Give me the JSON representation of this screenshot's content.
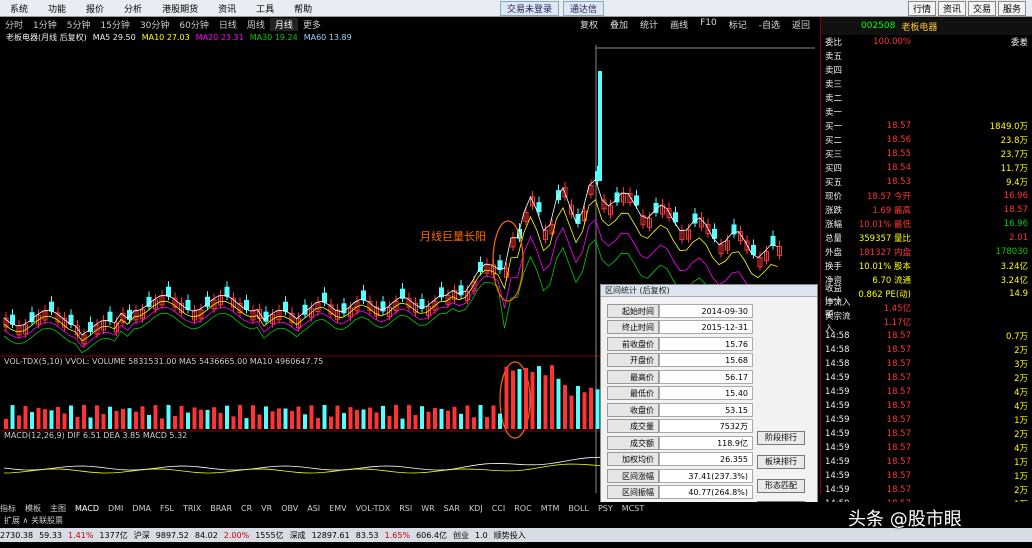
{
  "menu": {
    "items": [
      "系统",
      "功能",
      "报价",
      "分析",
      "港股期货",
      "资讯",
      "工具",
      "帮助"
    ],
    "center": [
      "交易未登录",
      "通达信"
    ],
    "right": [
      "行情",
      "资讯",
      "交易",
      "服务"
    ]
  },
  "periods": {
    "items": [
      "分时",
      "1分钟",
      "5分钟",
      "15分钟",
      "30分钟",
      "60分钟",
      "日线",
      "周线",
      "月线",
      "更多"
    ],
    "active": "月线",
    "tools": [
      "复权",
      "叠加",
      "统计",
      "画线",
      "F10",
      "标记",
      "-自选",
      "返回"
    ]
  },
  "ma_line": {
    "title": "老板电器(月线 后复权)",
    "ma5": "MA5 29.50",
    "ma10": "MA10 27.03",
    "ma20": "MA20 23.31",
    "ma30": "MA30 19.24",
    "ma60": "MA60 13.89"
  },
  "annotation": "月线巨量长阳",
  "vol_line": "VOL-TDX(5,10) VVOL: VOLUME 5831531.00 MA5 5436665.00 MA10 4960647.75",
  "macd_line": "MACD(12,26,9) DIF 6.51 DEA 3.85 MACD 5.32",
  "indicators": [
    "指标",
    "模板",
    "主图",
    "MACD",
    "DMI",
    "DMA",
    "FSL",
    "TRIX",
    "BRAR",
    "CR",
    "VR",
    "OBV",
    "ASI",
    "EMV",
    "VOL-TDX",
    "RSI",
    "WR",
    "SAR",
    "KDJ",
    "CCI",
    "ROC",
    "MTM",
    "BOLL",
    "PSY",
    "MCST"
  ],
  "ext_line": "扩展 ∧ 关联股票",
  "stock": {
    "code": "002508",
    "name": "老板电器",
    "ratio": "100.00%",
    "diff": "委差"
  },
  "rp_rows": [
    {
      "l": "委比",
      "p": "100.00%",
      "v": "委差",
      "pc": "red",
      "vc": "wht"
    },
    {
      "l": "卖五",
      "p": "",
      "v": "",
      "pc": "red",
      "vc": "yel"
    },
    {
      "l": "卖四",
      "p": "",
      "v": "",
      "pc": "red",
      "vc": "yel"
    },
    {
      "l": "卖三",
      "p": "",
      "v": "",
      "pc": "red",
      "vc": "yel"
    },
    {
      "l": "卖二",
      "p": "",
      "v": "",
      "pc": "red",
      "vc": "yel"
    },
    {
      "l": "卖一",
      "p": "",
      "v": "",
      "pc": "red",
      "vc": "yel"
    },
    {
      "l": "买一",
      "p": "18.57",
      "v": "1849.0万",
      "pc": "red",
      "vc": "yel"
    },
    {
      "l": "买二",
      "p": "18.56",
      "v": "23.8万",
      "pc": "red",
      "vc": "yel"
    },
    {
      "l": "买三",
      "p": "18.55",
      "v": "23.7万",
      "pc": "red",
      "vc": "yel"
    },
    {
      "l": "买四",
      "p": "18.54",
      "v": "11.7万",
      "pc": "red",
      "vc": "yel"
    },
    {
      "l": "买五",
      "p": "18.53",
      "v": "9.4万",
      "pc": "red",
      "vc": "yel"
    },
    {
      "l": "现价",
      "p": "18.57 今开",
      "v": "16.96",
      "pc": "red",
      "vc": "red"
    },
    {
      "l": "涨跌",
      "p": "1.69 最高",
      "v": "18.57",
      "pc": "red",
      "vc": "red"
    },
    {
      "l": "涨幅",
      "p": "10.01% 最低",
      "v": "16.96",
      "pc": "red",
      "vc": "grn"
    },
    {
      "l": "总量",
      "p": "359357 量比",
      "v": "2.01",
      "pc": "yel",
      "vc": "red"
    },
    {
      "l": "外盘",
      "p": "181327 内盘",
      "v": "178030",
      "pc": "red",
      "vc": "grn"
    },
    {
      "l": "换手",
      "p": "10.01% 股本",
      "v": "3.24亿",
      "pc": "yel",
      "vc": "yel"
    },
    {
      "l": "净资",
      "p": "6.70 流通",
      "v": "3.24亿",
      "pc": "yel",
      "vc": "yel"
    },
    {
      "l": "收益(一)",
      "p": "0.862 PE(动)",
      "v": "14.9",
      "pc": "yel",
      "vc": "yel"
    },
    {
      "l": "净流入额",
      "p": "1.45亿",
      "v": "",
      "pc": "red",
      "vc": "red"
    },
    {
      "l": "大宗流入",
      "p": "1.17亿",
      "v": "",
      "pc": "red",
      "vc": "red"
    }
  ],
  "ticks": [
    {
      "t": "14:58",
      "p": "18.57",
      "v": "0.7万"
    },
    {
      "t": "14:58",
      "p": "18.57",
      "v": "2万"
    },
    {
      "t": "14:58",
      "p": "18.57",
      "v": "3万"
    },
    {
      "t": "14:59",
      "p": "18.57",
      "v": "2万"
    },
    {
      "t": "14:59",
      "p": "18.57",
      "v": "4万"
    },
    {
      "t": "14:59",
      "p": "18.57",
      "v": "4万"
    },
    {
      "t": "14:59",
      "p": "18.57",
      "v": "1万"
    },
    {
      "t": "14:59",
      "p": "18.57",
      "v": "2万"
    },
    {
      "t": "14:59",
      "p": "18.57",
      "v": "4万"
    },
    {
      "t": "14:59",
      "p": "18.57",
      "v": "1万"
    },
    {
      "t": "14:59",
      "p": "18.57",
      "v": "1万"
    },
    {
      "t": "14:59",
      "p": "18.57",
      "v": "2万"
    },
    {
      "t": "14:59",
      "p": "18.57",
      "v": "1万"
    },
    {
      "t": "14:59",
      "p": "18.57",
      "v": "2万"
    }
  ],
  "dialog": {
    "title": "区间统计 (后复权)",
    "rows": [
      {
        "label": "起始时间",
        "value": "2014-09-30"
      },
      {
        "label": "终止时间",
        "value": "2015-12-31"
      },
      {
        "label": "前收盘价",
        "value": "15.76"
      },
      {
        "label": "开盘价",
        "value": "15.68"
      },
      {
        "label": "最高价",
        "value": "56.17"
      },
      {
        "label": "最低价",
        "value": "15.40"
      },
      {
        "label": "收盘价",
        "value": "53.15"
      },
      {
        "label": "成交量",
        "value": "7532万"
      },
      {
        "label": "成交额",
        "value": "118.9亿"
      },
      {
        "label": "加权均价",
        "value": "26.355"
      },
      {
        "label": "区间涨幅",
        "value": "37.41(237.3%)"
      },
      {
        "label": "区间振幅",
        "value": "40.77(264.8%)"
      },
      {
        "label": "区间换手",
        "value": "25.72%"
      }
    ],
    "buttons": [
      "阶段排行",
      "板块排行",
      "形态匹配",
      "关闭"
    ]
  },
  "bottom": [
    "2730.38",
    "59.33",
    "1.41%",
    "1377亿",
    "沪深",
    "9897.52",
    "84.02",
    "2.00%",
    "1555亿",
    "深成",
    "12897.61",
    "83.53",
    "1.65%",
    "606.4亿",
    "创业",
    "1.0",
    "顺势投入"
  ],
  "watermark": "头条 @股市眼"
}
